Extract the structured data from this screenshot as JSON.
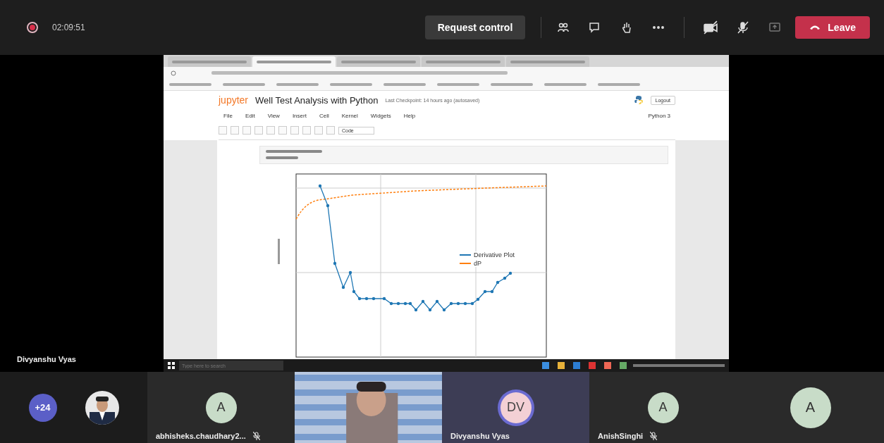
{
  "top_bar": {
    "recording": true,
    "timer": "02:09:51",
    "request_control": "Request control",
    "leave": "Leave"
  },
  "browser": {
    "tabs": [
      {
        "selected": false
      },
      {
        "selected": true
      },
      {
        "selected": false
      },
      {
        "selected": false
      },
      {
        "selected": false
      }
    ]
  },
  "notebook": {
    "logo": "jupyter",
    "title": "Well Test Analysis with Python",
    "checkpoint": "Last Checkpoint: 14 hours ago (autosaved)",
    "logout": "Logout",
    "kernel": "Python 3",
    "menu": [
      "File",
      "Edit",
      "View",
      "Insert",
      "Cell",
      "Kernel",
      "Widgets",
      "Help"
    ],
    "cell_type": "Code",
    "legend": [
      {
        "label": "Derivative Plot",
        "color": "#1f77b4"
      },
      {
        "label": "dP",
        "color": "#ff7f0e"
      }
    ]
  },
  "taskbar": {
    "search_placeholder": "Type here to search"
  },
  "presenter_label": "Divyanshu Vyas",
  "tiles": [
    {
      "kind": "overflow",
      "label": "+24"
    },
    {
      "kind": "avatar",
      "initials": "A",
      "name": "abhisheks.chaudhary2...",
      "muted": true,
      "speaking": false
    },
    {
      "kind": "video"
    },
    {
      "kind": "avatar",
      "initials": "DV",
      "name": "Divyanshu Vyas",
      "speaking": true
    },
    {
      "kind": "avatar",
      "initials": "A",
      "name": "AnishSinghi",
      "muted": true,
      "speaking": false
    },
    {
      "kind": "avatar",
      "initials": "A",
      "speaking": false
    }
  ]
}
